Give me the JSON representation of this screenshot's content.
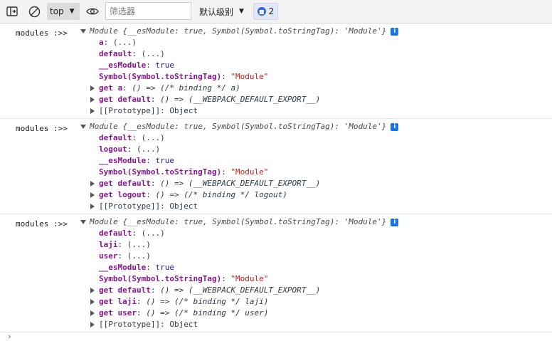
{
  "toolbar": {
    "sidebar_icon": "sidebar-toggle-icon",
    "clear_icon": "clear-console-icon",
    "context_label": "top",
    "eye_icon": "live-expression-eye-icon",
    "filter_placeholder": "筛选器",
    "level_label": "默认级别",
    "issues_count": "2"
  },
  "entries": [
    {
      "prefix": "modules :>>",
      "summary": "Module {__esModule: true, Symbol(Symbol.toStringTag): 'Module'}",
      "lines": [
        {
          "kind": "prop",
          "key": "a",
          "value": "(...)"
        },
        {
          "kind": "prop",
          "key": "default",
          "value": "(...)"
        },
        {
          "kind": "bool",
          "key": "__esModule",
          "value": "true"
        },
        {
          "kind": "str",
          "key": "Symbol(Symbol.toStringTag)",
          "value": "\"Module\""
        },
        {
          "kind": "getter",
          "key": "get a",
          "value": "() => (/* binding */ a)"
        },
        {
          "kind": "getter",
          "key": "get default",
          "value": "() => (__WEBPACK_DEFAULT_EXPORT__)"
        },
        {
          "kind": "proto",
          "key": "[[Prototype]]",
          "value": "Object"
        }
      ]
    },
    {
      "prefix": "modules :>>",
      "summary": "Module {__esModule: true, Symbol(Symbol.toStringTag): 'Module'}",
      "lines": [
        {
          "kind": "prop",
          "key": "default",
          "value": "(...)"
        },
        {
          "kind": "prop",
          "key": "logout",
          "value": "(...)"
        },
        {
          "kind": "bool",
          "key": "__esModule",
          "value": "true"
        },
        {
          "kind": "str",
          "key": "Symbol(Symbol.toStringTag)",
          "value": "\"Module\""
        },
        {
          "kind": "getter",
          "key": "get default",
          "value": "() => (__WEBPACK_DEFAULT_EXPORT__)"
        },
        {
          "kind": "getter",
          "key": "get logout",
          "value": "() => (/* binding */ logout)"
        },
        {
          "kind": "proto",
          "key": "[[Prototype]]",
          "value": "Object"
        }
      ]
    },
    {
      "prefix": "modules :>>",
      "summary": "Module {__esModule: true, Symbol(Symbol.toStringTag): 'Module'}",
      "lines": [
        {
          "kind": "prop",
          "key": "default",
          "value": "(...)"
        },
        {
          "kind": "prop",
          "key": "laji",
          "value": "(...)"
        },
        {
          "kind": "prop",
          "key": "user",
          "value": "(...)"
        },
        {
          "kind": "bool",
          "key": "__esModule",
          "value": "true"
        },
        {
          "kind": "str",
          "key": "Symbol(Symbol.toStringTag)",
          "value": "\"Module\""
        },
        {
          "kind": "getter",
          "key": "get default",
          "value": "() => (__WEBPACK_DEFAULT_EXPORT__)"
        },
        {
          "kind": "getter",
          "key": "get laji",
          "value": "() => (/* binding */ laji)"
        },
        {
          "kind": "getter",
          "key": "get user",
          "value": "() => (/* binding */ user)"
        },
        {
          "kind": "proto",
          "key": "[[Prototype]]",
          "value": "Object"
        }
      ]
    }
  ]
}
